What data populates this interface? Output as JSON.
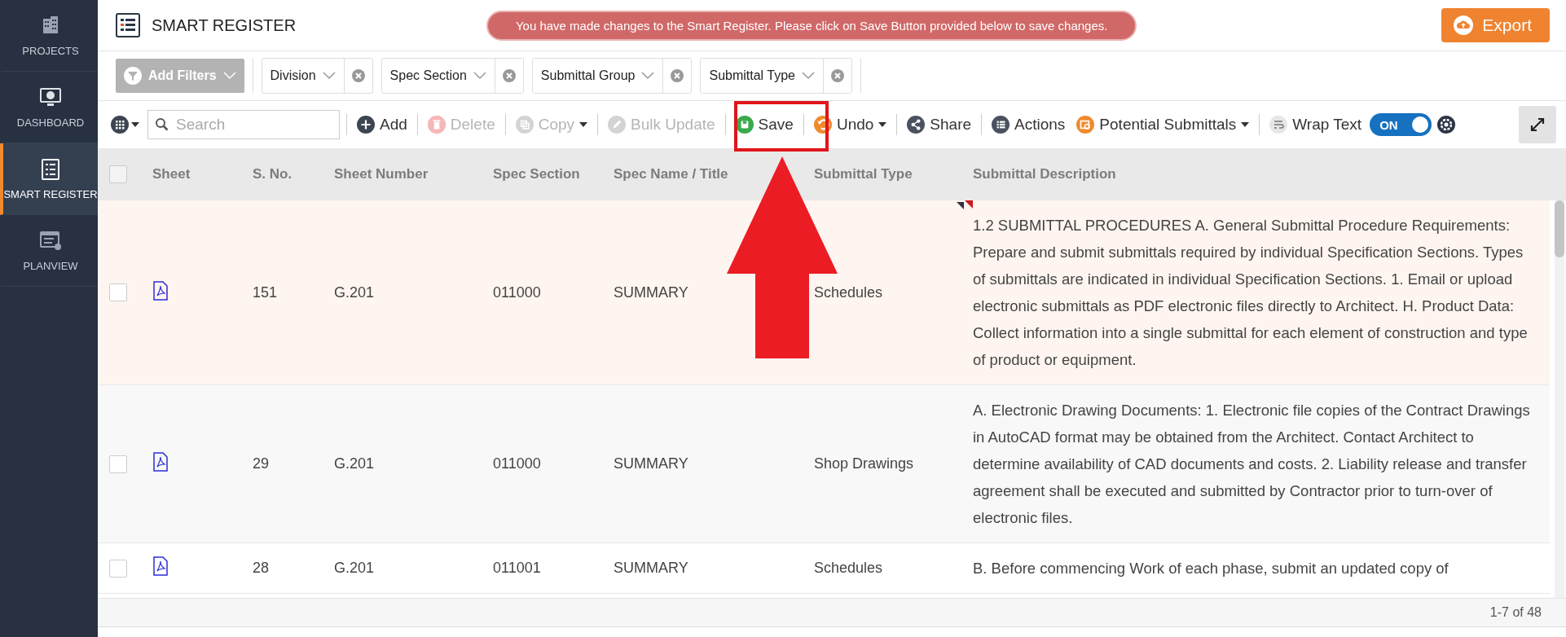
{
  "sidebar": {
    "items": [
      {
        "label": "PROJECTS",
        "selected": false
      },
      {
        "label": "DASHBOARD",
        "selected": false
      },
      {
        "label": "SMART REGISTER",
        "selected": true
      },
      {
        "label": "PLANVIEW",
        "selected": false
      }
    ]
  },
  "header": {
    "title": "SMART REGISTER",
    "notice": "You have made changes to the Smart Register. Please click on Save Button provided below to save changes.",
    "export_label": "Export"
  },
  "filters": {
    "add_label": "Add Filters",
    "chips": [
      "Division",
      "Spec Section",
      "Submittal Group",
      "Submittal Type"
    ]
  },
  "toolbar": {
    "search_placeholder": "Search",
    "actions": [
      {
        "label": "Add",
        "disabled": false,
        "dropdown": false
      },
      {
        "label": "Delete",
        "disabled": true,
        "dropdown": false
      },
      {
        "label": "Copy",
        "disabled": true,
        "dropdown": true
      },
      {
        "label": "Bulk Update",
        "disabled": true,
        "dropdown": false
      },
      {
        "label": "Save",
        "disabled": false,
        "dropdown": false
      },
      {
        "label": "Undo",
        "disabled": false,
        "dropdown": true
      },
      {
        "label": "Share",
        "disabled": false,
        "dropdown": false
      },
      {
        "label": "Actions",
        "disabled": false,
        "dropdown": false
      },
      {
        "label": "Potential Submittals",
        "disabled": false,
        "dropdown": true
      }
    ],
    "wrap_text": {
      "label": "Wrap Text",
      "toggle_label": "ON",
      "on": true
    }
  },
  "table": {
    "select_all": {
      "checked": false
    },
    "columns": [
      "Sheet",
      "S. No.",
      "Sheet Number",
      "Spec Section",
      "Spec Name / Title",
      "Submittal Type",
      "Submittal Description"
    ],
    "rows": [
      {
        "checked": false,
        "modified": true,
        "s_no": "151",
        "sheet_number": "G.201",
        "spec_section": "011000",
        "spec_name": "SUMMARY",
        "submittal_type": "Schedules",
        "description": "1.2 SUBMITTAL PROCEDURES A. General Submittal Procedure Requirements: Prepare and submit submittals required by individual Specification Sections. Types of submittals are indicated in individual Specification Sections. 1. Email or upload electronic submittals as PDF electronic files directly to Architect. H. Product Data: Collect information into a single submittal for each element of construction and type of product or equipment."
      },
      {
        "checked": false,
        "modified": false,
        "s_no": "29",
        "sheet_number": "G.201",
        "spec_section": "011000",
        "spec_name": "SUMMARY",
        "submittal_type": "Shop Drawings",
        "description": "A. Electronic Drawing Documents: 1. Electronic file copies of the Contract Drawings in AutoCAD format may be obtained from the Architect. Contact Architect to determine availability of CAD documents and costs. 2. Liability release and transfer agreement shall be executed and submitted by Contractor prior to turn-over of electronic files."
      },
      {
        "checked": false,
        "modified": false,
        "s_no": "28",
        "sheet_number": "G.201",
        "spec_section": "011001",
        "spec_name": "SUMMARY",
        "submittal_type": "Schedules",
        "description": "B. Before commencing Work of each phase, submit an updated copy of"
      }
    ],
    "pagination": "1-7 of 48"
  }
}
